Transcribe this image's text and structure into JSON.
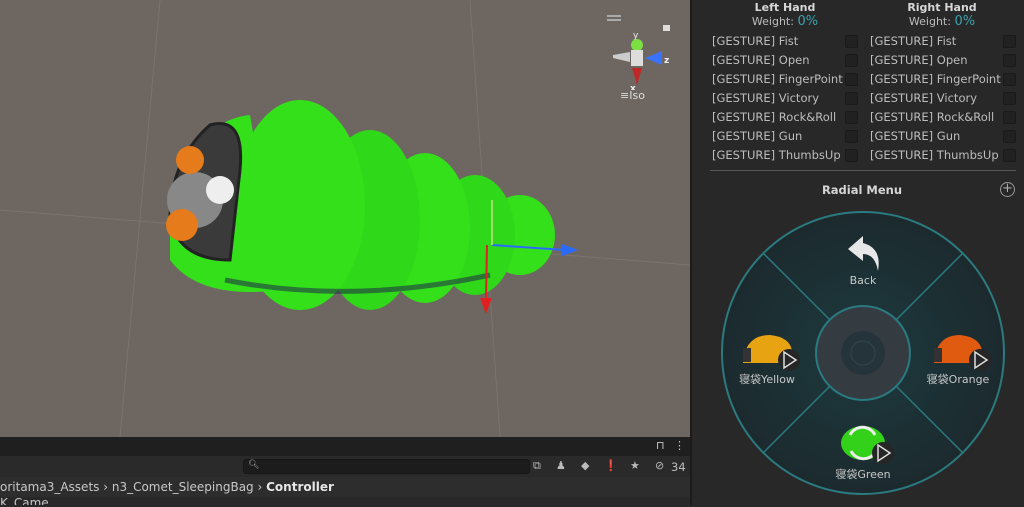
{
  "scene": {
    "gizmo": {
      "y": "y",
      "x": "x",
      "z": "z"
    },
    "view_mode": "Iso",
    "colors": {
      "bag": "#33e01a",
      "background": "#6e6761"
    }
  },
  "bottom": {
    "count": "34",
    "breadcrumb": [
      "oritama3_Assets",
      "n3_Comet_SleepingBag",
      "Controller"
    ],
    "asset_row": "K_Came"
  },
  "panel": {
    "left_hand": {
      "title": "Left Hand",
      "weight_label": "Weight:",
      "weight_value": "0%"
    },
    "right_hand": {
      "title": "Right Hand",
      "weight_label": "Weight:",
      "weight_value": "0%"
    },
    "gestures": [
      "[GESTURE] Fist",
      "[GESTURE] Open",
      "[GESTURE] FingerPoint",
      "[GESTURE] Victory",
      "[GESTURE] Rock&Roll",
      "[GESTURE] Gun",
      "[GESTURE] ThumbsUp"
    ],
    "radial_title": "Radial Menu",
    "radial_items": {
      "top": "Back",
      "left": "寝袋Yellow",
      "right": "寝袋Orange",
      "bottom": "寝袋Green"
    },
    "colors": {
      "radial_ring": "#2a7a80",
      "accent": "#3aa3ad",
      "yellow": "#e8a312",
      "orange": "#e05a10",
      "green": "#33d11a"
    }
  }
}
